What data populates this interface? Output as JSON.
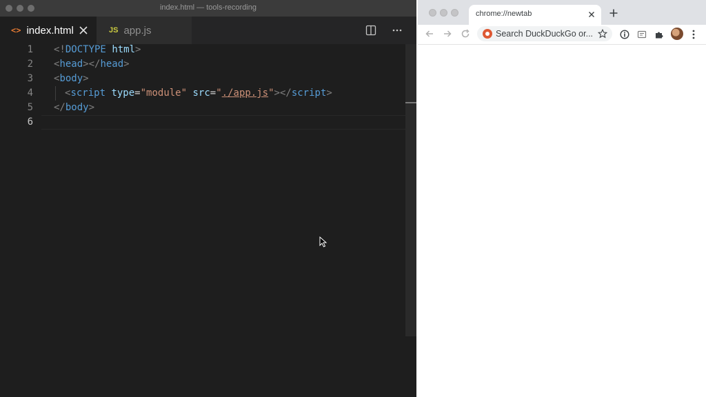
{
  "vscode": {
    "window_title": "index.html — tools-recording",
    "tabs": [
      {
        "label": "index.html",
        "icon": "html-icon",
        "icon_glyph": "<>",
        "active": true
      },
      {
        "label": "app.js",
        "icon": "js-icon",
        "icon_glyph": "JS",
        "active": false
      }
    ],
    "line_numbers": [
      "1",
      "2",
      "3",
      "4",
      "5",
      "6"
    ],
    "current_line": "6",
    "code": {
      "l1": {
        "p1": "<!",
        "doctype": "DOCTYPE",
        "sp": " ",
        "html": "html",
        "p2": ">"
      },
      "l2": {
        "p1": "<",
        "t1": "head",
        "p2": "></",
        "t2": "head",
        "p3": ">"
      },
      "l3": {
        "p1": "<",
        "t1": "body",
        "p2": ">"
      },
      "l4": {
        "p1": "<",
        "t1": "script",
        "sp1": " ",
        "a1": "type",
        "eq1": "=",
        "v1": "\"module\"",
        "sp2": " ",
        "a2": "src",
        "eq2": "=",
        "q1": "\"",
        "v2": "./app.js",
        "q2": "\"",
        "p2": "></",
        "t2": "script",
        "p3": ">"
      },
      "l5": {
        "p1": "</",
        "t1": "body",
        "p2": ">"
      }
    },
    "colors": {
      "background": "#1e1e1e",
      "tag": "#569cd6",
      "attribute": "#9cdcfe",
      "string": "#ce9178"
    }
  },
  "chrome": {
    "tab_title": "chrome://newtab",
    "omnibox_placeholder": "Search DuckDuckGo or...",
    "icons": [
      "back-arrow-icon",
      "forward-arrow-icon",
      "reload-icon",
      "duckduckgo-icon",
      "star-icon",
      "info-extension-icon",
      "reader-extension-icon",
      "puzzle-extensions-icon",
      "profile-avatar",
      "kebab-menu-icon"
    ]
  }
}
